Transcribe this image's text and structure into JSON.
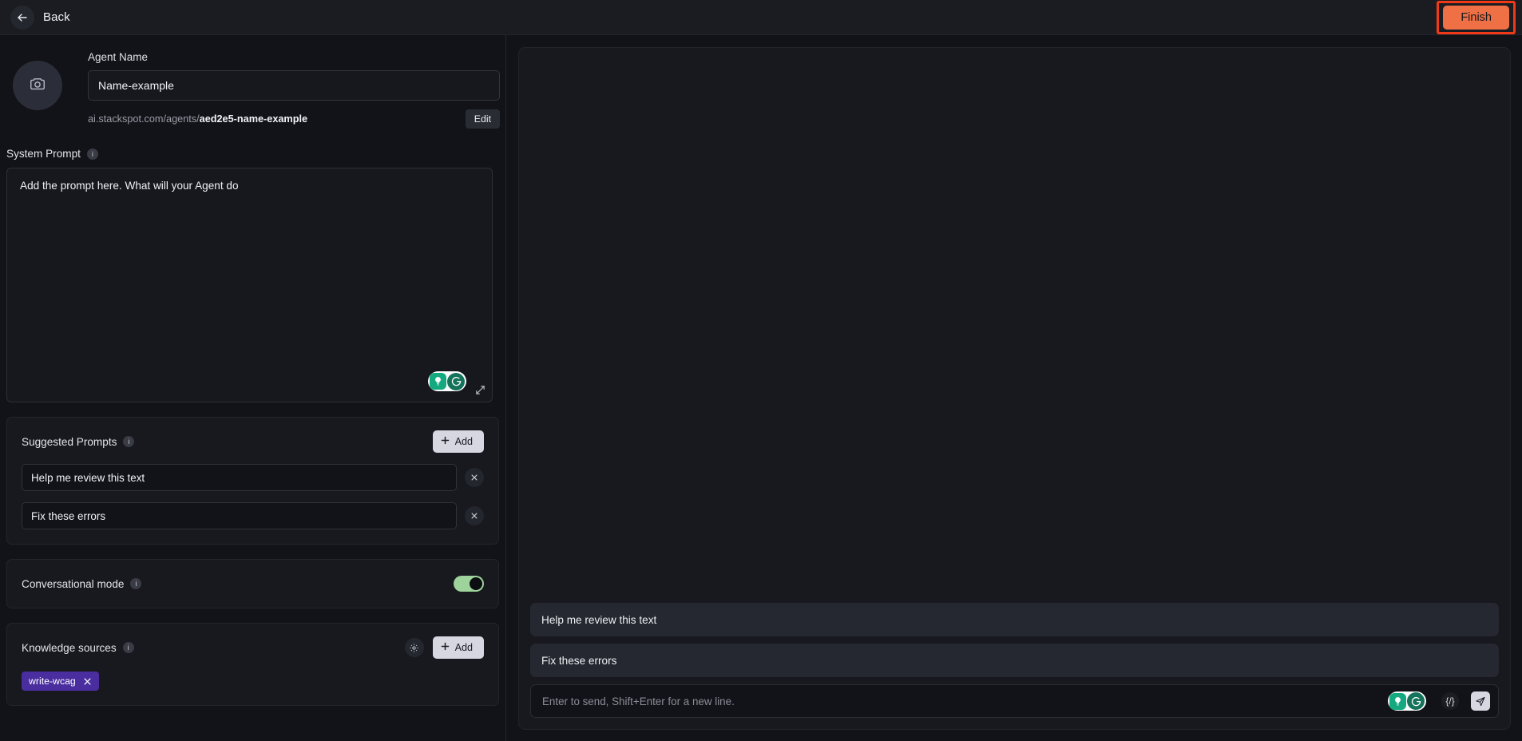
{
  "topbar": {
    "back_label": "Back",
    "back_icon": "arrow-left-icon",
    "finish_label": "Finish",
    "finish_color": "#ef7045",
    "highlight_color": "#f03a17"
  },
  "identity": {
    "avatar_icon": "camera-icon",
    "name_label": "Agent Name",
    "name_value": "Name-example",
    "name_placeholder": "Agent Name",
    "url_prefix": "ai.stackspot.com/agents/",
    "url_slug": "aed2e5-name-example",
    "edit_label": "Edit"
  },
  "system_prompt": {
    "title": "System Prompt",
    "info_icon": "info-icon",
    "placeholder": "Add the prompt here. What will your Agent do",
    "value": "",
    "grammarly_icon": "grammarly-icon",
    "resize_icon": "resize-handle-icon"
  },
  "suggested_prompts": {
    "title": "Suggested Prompts",
    "info_icon": "info-icon",
    "add_label": "Add",
    "add_icon": "plus-icon",
    "items": [
      {
        "value": "Help me review this text",
        "remove_icon": "close-icon"
      },
      {
        "value": "Fix these errors",
        "remove_icon": "close-icon"
      }
    ]
  },
  "conversational_mode": {
    "title": "Conversational mode",
    "info_icon": "info-icon",
    "enabled": true,
    "toggle_color": "#9ed49b"
  },
  "knowledge_sources": {
    "title": "Knowledge sources",
    "info_icon": "info-icon",
    "settings_icon": "gear-icon",
    "add_label": "Add",
    "add_icon": "plus-icon",
    "tags": [
      {
        "label": "write-wcag",
        "color": "#4a2ea0",
        "remove_icon": "close-icon"
      }
    ]
  },
  "chat": {
    "suggestions": [
      "Help me review this text",
      "Fix these errors"
    ],
    "input_placeholder": "Enter to send, Shift+Enter for a new line.",
    "input_value": "",
    "grammarly_icon": "grammarly-icon",
    "code_icon": "code-braces-icon",
    "code_glyph": "{/}",
    "send_icon": "send-icon"
  }
}
